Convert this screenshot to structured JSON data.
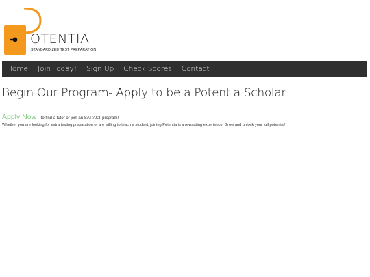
{
  "logo": {
    "initial": "P",
    "wordmark": "OTENTIA",
    "tagline": "STANDARDIZED TEST PREPARATION",
    "accent_color": "#f39a1e"
  },
  "nav": {
    "background": "#2f2f2f",
    "items": [
      {
        "label": "Home"
      },
      {
        "label": "Join Today!"
      },
      {
        "label": "Sign Up"
      },
      {
        "label": "Check Scores"
      },
      {
        "label": "Contact"
      }
    ]
  },
  "main": {
    "heading": "Begin Our Program- Apply to be a Potentia Scholar",
    "apply_link": "Apply Now",
    "apply_text": "to find a tutor or join an SAT/ACT program!",
    "description": "Whether you are looking for extra testing preparation or are willing to teach a student, joining Potentia is a rewarding experience. Grow and unlock your full potential!",
    "link_color": "#7fc97f"
  }
}
